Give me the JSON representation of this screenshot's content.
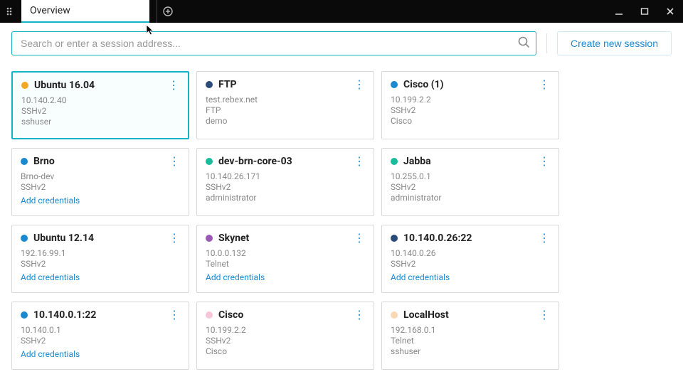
{
  "titlebar": {
    "tab_label": "Overview"
  },
  "toolbar": {
    "search_placeholder": "Search or enter a session address...",
    "create_label": "Create new session"
  },
  "colors": {
    "orange": "#f5a623",
    "darkblue": "#2b4b7a",
    "blue": "#1a89d0",
    "teal": "#1abc9c",
    "purple": "#9b59b6",
    "pink": "#f7c6d9",
    "peach": "#f9d9b5"
  },
  "add_cred_label": "Add credentials",
  "cards": [
    {
      "name": "Ubuntu 16.04",
      "color": "orange",
      "lines": [
        "10.140.2.40",
        "SSHv2",
        "sshuser"
      ],
      "add_cred": false,
      "selected": true
    },
    {
      "name": "FTP",
      "color": "darkblue",
      "lines": [
        "test.rebex.net",
        "FTP",
        "demo"
      ],
      "add_cred": false,
      "selected": false
    },
    {
      "name": "Cisco (1)",
      "color": "blue",
      "lines": [
        "10.199.2.2",
        "SSHv2",
        "Cisco"
      ],
      "add_cred": false,
      "selected": false
    },
    {
      "name": "Brno",
      "color": "blue",
      "lines": [
        "Brno-dev",
        "SSHv2"
      ],
      "add_cred": true,
      "selected": false
    },
    {
      "name": "dev-brn-core-03",
      "color": "teal",
      "lines": [
        "10.140.26.171",
        "SSHv2",
        "administrator"
      ],
      "add_cred": false,
      "selected": false
    },
    {
      "name": "Jabba",
      "color": "teal",
      "lines": [
        "10.255.0.1",
        "SSHv2",
        "administrator"
      ],
      "add_cred": false,
      "selected": false
    },
    {
      "name": "Ubuntu 12.14",
      "color": "blue",
      "lines": [
        "192.16.99.1",
        "SSHv2"
      ],
      "add_cred": true,
      "selected": false
    },
    {
      "name": "Skynet",
      "color": "purple",
      "lines": [
        "10.0.0.132",
        "Telnet"
      ],
      "add_cred": true,
      "selected": false
    },
    {
      "name": "10.140.0.26:22",
      "color": "darkblue",
      "lines": [
        "10.140.0.26",
        "SSHv2"
      ],
      "add_cred": true,
      "selected": false
    },
    {
      "name": "10.140.0.1:22",
      "color": "blue",
      "lines": [
        "10.140.0.1",
        "SSHv2"
      ],
      "add_cred": true,
      "selected": false
    },
    {
      "name": "Cisco",
      "color": "pink",
      "lines": [
        "10.199.2.2",
        "SSHv2",
        "Cisco"
      ],
      "add_cred": false,
      "selected": false
    },
    {
      "name": "LocalHost",
      "color": "peach",
      "lines": [
        "192.168.0.1",
        "Telnet",
        "sshuser"
      ],
      "add_cred": false,
      "selected": false
    }
  ]
}
